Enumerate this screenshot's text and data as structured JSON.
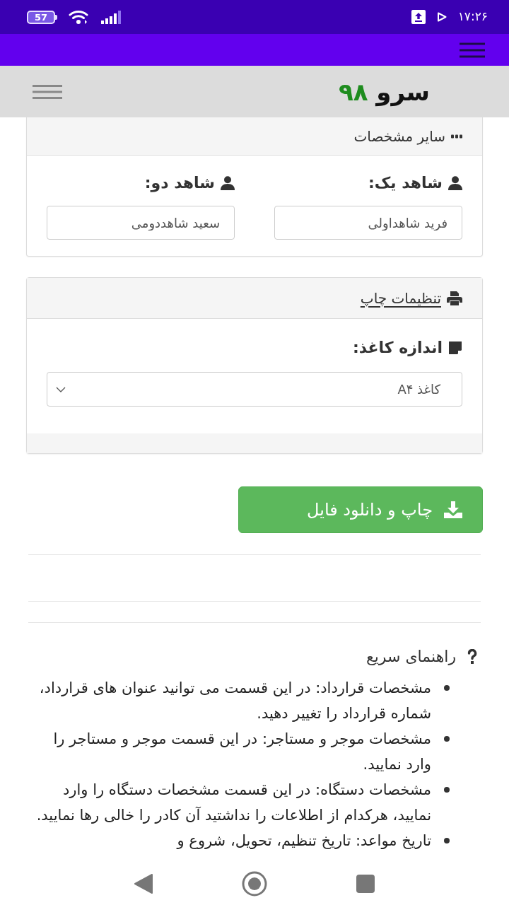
{
  "status_bar": {
    "time": "۱۷:۲۶",
    "battery": "57"
  },
  "navbar": {
    "brand": {
      "name": "سرو",
      "number": "۹۸"
    }
  },
  "witness_card": {
    "title": "سایر مشخصات",
    "fields": [
      {
        "label": "شاهد یک:",
        "value": "فرید شاهداولی"
      },
      {
        "label": "شاهد دو:",
        "value": "سعید شاهددومی"
      }
    ]
  },
  "print_card": {
    "title": "تنظیمات چاپ",
    "paper_size": {
      "label": "اندازه کاغذ:",
      "value": "کاغذ A۴"
    }
  },
  "download_button": {
    "label": "چاپ و دانلود فایل"
  },
  "quick_help": {
    "title": "راهنمای سریع",
    "items": [
      "مشخصات قرارداد: در این قسمت می توانید عنوان های قرارداد، شماره قرارداد را تغییر دهید.",
      "مشخصات موجر و مستاجر: در این قسمت موجر و مستاجر را وارد نمایید.",
      "مشخصات دستگاه: در این قسمت مشخصات دستگاه را وارد نمایید، هرکدام از اطلاعات را نداشتید آن کادر را خالی رها نمایید.",
      "تاریخ مواعد: تاریخ تنظیم، تحویل، شروع و"
    ]
  }
}
